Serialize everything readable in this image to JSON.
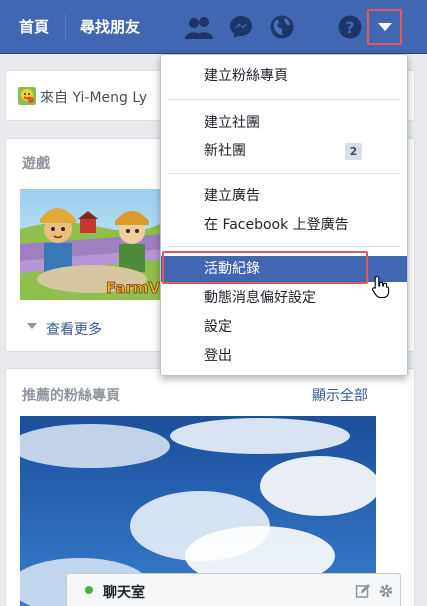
{
  "topbar": {
    "home_label": "首頁",
    "find_friends_label": "尋找朋友",
    "icons": [
      "friend-requests-icon",
      "messenger-icon",
      "notifications-globe-icon",
      "help-icon",
      "account-menu-caret-icon"
    ]
  },
  "feed": {
    "status_text": "來自 Yi-Meng Ly",
    "games": {
      "title": "遊戲",
      "image_banner": "FarmVi",
      "see_more_label": "查看更多"
    },
    "suggested_pages": {
      "title": "推薦的粉絲專頁",
      "show_all_label": "顯示全部"
    }
  },
  "menu": {
    "items": [
      {
        "label": "建立粉絲專頁"
      },
      {
        "label": "建立社團"
      },
      {
        "label": "新社團",
        "badge": "2"
      },
      {
        "label": "建立廣告"
      },
      {
        "label": "在 Facebook 上登廣告"
      },
      {
        "label": "活動紀錄",
        "active": true
      },
      {
        "label": "動態消息偏好設定"
      },
      {
        "label": "設定"
      },
      {
        "label": "登出"
      }
    ]
  },
  "chat": {
    "label": "聊天室",
    "status": "online"
  },
  "colors": {
    "brand": "#4267b2",
    "highlight_outline": "#e4575f",
    "link": "#365899",
    "online": "#42b72a"
  }
}
